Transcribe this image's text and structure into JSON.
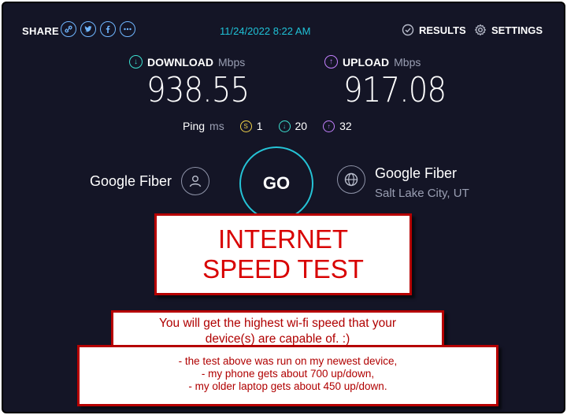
{
  "header": {
    "share_label": "SHARE",
    "share_icons": [
      "link-icon",
      "twitter-icon",
      "facebook-icon",
      "more-icon"
    ],
    "datetime": "11/24/2022 8:22 AM",
    "results_label": "RESULTS",
    "settings_label": "SETTINGS"
  },
  "download": {
    "label": "DOWNLOAD",
    "unit": "Mbps",
    "value": "938.55"
  },
  "upload": {
    "label": "UPLOAD",
    "unit": "Mbps",
    "value": "917.08"
  },
  "ping": {
    "label": "Ping",
    "unit": "ms",
    "idle": "1",
    "download": "20",
    "upload": "32"
  },
  "provider": {
    "name": "Google Fiber"
  },
  "server": {
    "name": "Google Fiber",
    "location": "Salt Lake City, UT"
  },
  "go_label": "GO",
  "overlay": {
    "title_line1": "INTERNET",
    "title_line2": "SPEED TEST",
    "note_line1": "You will get the highest wi-fi speed that your",
    "note_line2": "device(s) are capable of. :)",
    "detail_line1": "- the test above was run on my newest device,",
    "detail_line2": "- my phone gets about 700 up/down,",
    "detail_line3": "- my older laptop gets about 450 up/down."
  },
  "colors": {
    "background": "#141526",
    "accent_cyan": "#25c3d6",
    "download": "#3ce0d0",
    "upload": "#c481ff",
    "ping_idle": "#f2d34a",
    "overlay_red": "#c00000"
  }
}
